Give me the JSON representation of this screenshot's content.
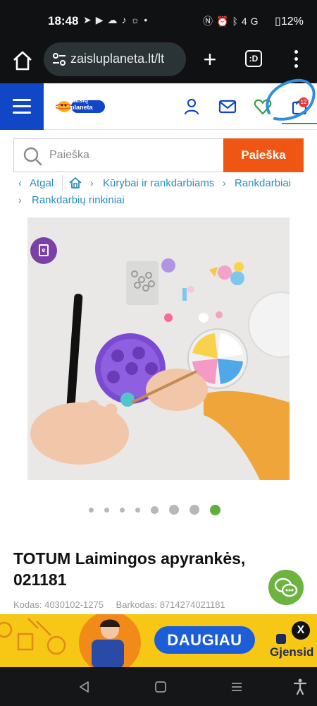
{
  "status_bar": {
    "time": "18:48",
    "left_icons": [
      "telegram-icon",
      "youtube-icon",
      "weather-icon",
      "tiktok-icon",
      "brightness-icon",
      "dot-icon"
    ],
    "right_icons": [
      "nfc-icon",
      "alarm-icon",
      "bluetooth-icon",
      "signal-4g-icon"
    ],
    "network_label": "4G",
    "battery": "12%"
  },
  "browser": {
    "url": "zaisluplaneta.lt/lt",
    "tabs_label": ":D"
  },
  "header": {
    "logo_text_1": "žaislų",
    "logo_text_2": "planeta",
    "cart_count": "12",
    "accent": "#1146c7"
  },
  "search": {
    "placeholder": "Paieška",
    "button_label": "Paieška",
    "button_color": "#ef5614"
  },
  "breadcrumb": {
    "back": "Atgal",
    "items": [
      "Kūrybai ir rankdarbiams",
      "Rankdarbiai",
      "Rankdarbių rinkiniai"
    ]
  },
  "product": {
    "title_line1": "TOTUM Laimingos apyrankės,",
    "title_line2": "021181",
    "code_text": "Kodas: 4030102-1275",
    "barcode_text": "Barkodas: 8714274021181",
    "badge_letter": "e"
  },
  "carousel": {
    "total": 8,
    "active_index": 7
  },
  "ad": {
    "cta": "DAUGIAU",
    "close": "X",
    "brand": "Gjensid"
  }
}
